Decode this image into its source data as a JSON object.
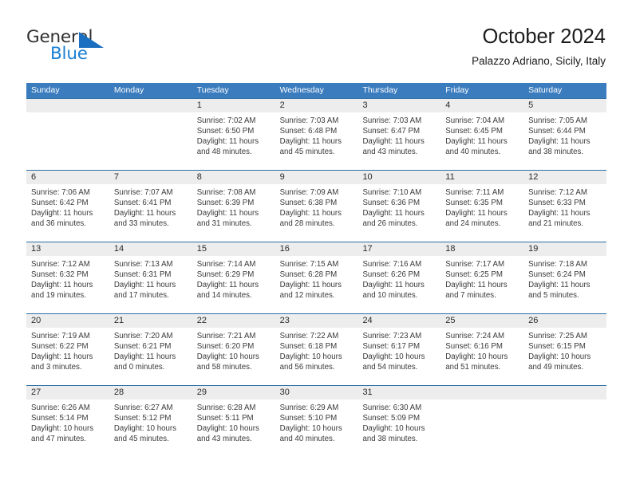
{
  "logo": {
    "word_top": "General",
    "word_bottom": "Blue",
    "triangle_color": "#1b6fc0",
    "blue_color": "#1b7fd4"
  },
  "header": {
    "title": "October 2024",
    "subtitle": "Palazzo Adriano, Sicily, Italy"
  },
  "colors": {
    "header_blue": "#3b7cbe",
    "row_divider_blue": "#2e6da4",
    "daynum_band": "#ededed"
  },
  "weekdays": [
    "Sunday",
    "Monday",
    "Tuesday",
    "Wednesday",
    "Thursday",
    "Friday",
    "Saturday"
  ],
  "weeks": [
    [
      {
        "day": "",
        "sunrise": "",
        "sunset": "",
        "daylight1": "",
        "daylight2": ""
      },
      {
        "day": "",
        "sunrise": "",
        "sunset": "",
        "daylight1": "",
        "daylight2": ""
      },
      {
        "day": "1",
        "sunrise": "Sunrise: 7:02 AM",
        "sunset": "Sunset: 6:50 PM",
        "daylight1": "Daylight: 11 hours",
        "daylight2": "and 48 minutes."
      },
      {
        "day": "2",
        "sunrise": "Sunrise: 7:03 AM",
        "sunset": "Sunset: 6:48 PM",
        "daylight1": "Daylight: 11 hours",
        "daylight2": "and 45 minutes."
      },
      {
        "day": "3",
        "sunrise": "Sunrise: 7:03 AM",
        "sunset": "Sunset: 6:47 PM",
        "daylight1": "Daylight: 11 hours",
        "daylight2": "and 43 minutes."
      },
      {
        "day": "4",
        "sunrise": "Sunrise: 7:04 AM",
        "sunset": "Sunset: 6:45 PM",
        "daylight1": "Daylight: 11 hours",
        "daylight2": "and 40 minutes."
      },
      {
        "day": "5",
        "sunrise": "Sunrise: 7:05 AM",
        "sunset": "Sunset: 6:44 PM",
        "daylight1": "Daylight: 11 hours",
        "daylight2": "and 38 minutes."
      }
    ],
    [
      {
        "day": "6",
        "sunrise": "Sunrise: 7:06 AM",
        "sunset": "Sunset: 6:42 PM",
        "daylight1": "Daylight: 11 hours",
        "daylight2": "and 36 minutes."
      },
      {
        "day": "7",
        "sunrise": "Sunrise: 7:07 AM",
        "sunset": "Sunset: 6:41 PM",
        "daylight1": "Daylight: 11 hours",
        "daylight2": "and 33 minutes."
      },
      {
        "day": "8",
        "sunrise": "Sunrise: 7:08 AM",
        "sunset": "Sunset: 6:39 PM",
        "daylight1": "Daylight: 11 hours",
        "daylight2": "and 31 minutes."
      },
      {
        "day": "9",
        "sunrise": "Sunrise: 7:09 AM",
        "sunset": "Sunset: 6:38 PM",
        "daylight1": "Daylight: 11 hours",
        "daylight2": "and 28 minutes."
      },
      {
        "day": "10",
        "sunrise": "Sunrise: 7:10 AM",
        "sunset": "Sunset: 6:36 PM",
        "daylight1": "Daylight: 11 hours",
        "daylight2": "and 26 minutes."
      },
      {
        "day": "11",
        "sunrise": "Sunrise: 7:11 AM",
        "sunset": "Sunset: 6:35 PM",
        "daylight1": "Daylight: 11 hours",
        "daylight2": "and 24 minutes."
      },
      {
        "day": "12",
        "sunrise": "Sunrise: 7:12 AM",
        "sunset": "Sunset: 6:33 PM",
        "daylight1": "Daylight: 11 hours",
        "daylight2": "and 21 minutes."
      }
    ],
    [
      {
        "day": "13",
        "sunrise": "Sunrise: 7:12 AM",
        "sunset": "Sunset: 6:32 PM",
        "daylight1": "Daylight: 11 hours",
        "daylight2": "and 19 minutes."
      },
      {
        "day": "14",
        "sunrise": "Sunrise: 7:13 AM",
        "sunset": "Sunset: 6:31 PM",
        "daylight1": "Daylight: 11 hours",
        "daylight2": "and 17 minutes."
      },
      {
        "day": "15",
        "sunrise": "Sunrise: 7:14 AM",
        "sunset": "Sunset: 6:29 PM",
        "daylight1": "Daylight: 11 hours",
        "daylight2": "and 14 minutes."
      },
      {
        "day": "16",
        "sunrise": "Sunrise: 7:15 AM",
        "sunset": "Sunset: 6:28 PM",
        "daylight1": "Daylight: 11 hours",
        "daylight2": "and 12 minutes."
      },
      {
        "day": "17",
        "sunrise": "Sunrise: 7:16 AM",
        "sunset": "Sunset: 6:26 PM",
        "daylight1": "Daylight: 11 hours",
        "daylight2": "and 10 minutes."
      },
      {
        "day": "18",
        "sunrise": "Sunrise: 7:17 AM",
        "sunset": "Sunset: 6:25 PM",
        "daylight1": "Daylight: 11 hours",
        "daylight2": "and 7 minutes."
      },
      {
        "day": "19",
        "sunrise": "Sunrise: 7:18 AM",
        "sunset": "Sunset: 6:24 PM",
        "daylight1": "Daylight: 11 hours",
        "daylight2": "and 5 minutes."
      }
    ],
    [
      {
        "day": "20",
        "sunrise": "Sunrise: 7:19 AM",
        "sunset": "Sunset: 6:22 PM",
        "daylight1": "Daylight: 11 hours",
        "daylight2": "and 3 minutes."
      },
      {
        "day": "21",
        "sunrise": "Sunrise: 7:20 AM",
        "sunset": "Sunset: 6:21 PM",
        "daylight1": "Daylight: 11 hours",
        "daylight2": "and 0 minutes."
      },
      {
        "day": "22",
        "sunrise": "Sunrise: 7:21 AM",
        "sunset": "Sunset: 6:20 PM",
        "daylight1": "Daylight: 10 hours",
        "daylight2": "and 58 minutes."
      },
      {
        "day": "23",
        "sunrise": "Sunrise: 7:22 AM",
        "sunset": "Sunset: 6:18 PM",
        "daylight1": "Daylight: 10 hours",
        "daylight2": "and 56 minutes."
      },
      {
        "day": "24",
        "sunrise": "Sunrise: 7:23 AM",
        "sunset": "Sunset: 6:17 PM",
        "daylight1": "Daylight: 10 hours",
        "daylight2": "and 54 minutes."
      },
      {
        "day": "25",
        "sunrise": "Sunrise: 7:24 AM",
        "sunset": "Sunset: 6:16 PM",
        "daylight1": "Daylight: 10 hours",
        "daylight2": "and 51 minutes."
      },
      {
        "day": "26",
        "sunrise": "Sunrise: 7:25 AM",
        "sunset": "Sunset: 6:15 PM",
        "daylight1": "Daylight: 10 hours",
        "daylight2": "and 49 minutes."
      }
    ],
    [
      {
        "day": "27",
        "sunrise": "Sunrise: 6:26 AM",
        "sunset": "Sunset: 5:14 PM",
        "daylight1": "Daylight: 10 hours",
        "daylight2": "and 47 minutes."
      },
      {
        "day": "28",
        "sunrise": "Sunrise: 6:27 AM",
        "sunset": "Sunset: 5:12 PM",
        "daylight1": "Daylight: 10 hours",
        "daylight2": "and 45 minutes."
      },
      {
        "day": "29",
        "sunrise": "Sunrise: 6:28 AM",
        "sunset": "Sunset: 5:11 PM",
        "daylight1": "Daylight: 10 hours",
        "daylight2": "and 43 minutes."
      },
      {
        "day": "30",
        "sunrise": "Sunrise: 6:29 AM",
        "sunset": "Sunset: 5:10 PM",
        "daylight1": "Daylight: 10 hours",
        "daylight2": "and 40 minutes."
      },
      {
        "day": "31",
        "sunrise": "Sunrise: 6:30 AM",
        "sunset": "Sunset: 5:09 PM",
        "daylight1": "Daylight: 10 hours",
        "daylight2": "and 38 minutes."
      },
      {
        "day": "",
        "sunrise": "",
        "sunset": "",
        "daylight1": "",
        "daylight2": ""
      },
      {
        "day": "",
        "sunrise": "",
        "sunset": "",
        "daylight1": "",
        "daylight2": ""
      }
    ]
  ]
}
